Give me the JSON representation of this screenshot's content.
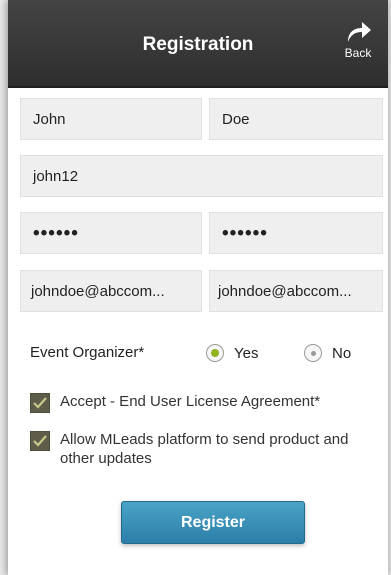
{
  "header": {
    "title": "Registration",
    "back_label": "Back"
  },
  "form": {
    "first_name": "John",
    "last_name": "Doe",
    "username": "john12",
    "password": "••••••",
    "confirm_password": "••••••",
    "email": "johndoe@abccom...",
    "confirm_email": "johndoe@abccom..."
  },
  "organizer": {
    "label": "Event Organizer*",
    "yes_label": "Yes",
    "no_label": "No",
    "selected": "Yes"
  },
  "checks": {
    "eula": {
      "label": "Accept - End User License Agreement*",
      "checked": true
    },
    "updates": {
      "label": "Allow MLeads platform to send product and other updates",
      "checked": true
    }
  },
  "register_label": "Register",
  "colors": {
    "header": "#333333",
    "radio_selected": "#8fb31f",
    "button": "#3a93bb",
    "checkbox": "#5d5d4a"
  }
}
